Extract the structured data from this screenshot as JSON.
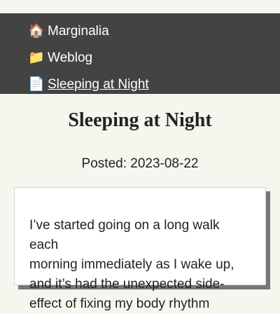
{
  "nav": {
    "items": [
      {
        "icon": "🏠",
        "icon_name": "house-icon",
        "label": "Marginalia"
      },
      {
        "icon": "📁",
        "icon_name": "folder-icon",
        "label": "Weblog"
      },
      {
        "icon": "📄",
        "icon_name": "page-icon",
        "label": "Sleeping at Night"
      }
    ]
  },
  "post": {
    "title": "Sleeping at Night",
    "posted": "Posted: 2023-08-22",
    "body_lines": [
      "I’ve started going on a long walk each",
      "morning immediately as I wake up,",
      "and it’s had the unexpected side-",
      "effect of fixing my body rhythm"
    ]
  },
  "colors": {
    "background": "#f6f5ee",
    "nav_background": "#434343",
    "nav_text": "#ffffff",
    "text": "#222222",
    "card_shadow": "#777777"
  }
}
